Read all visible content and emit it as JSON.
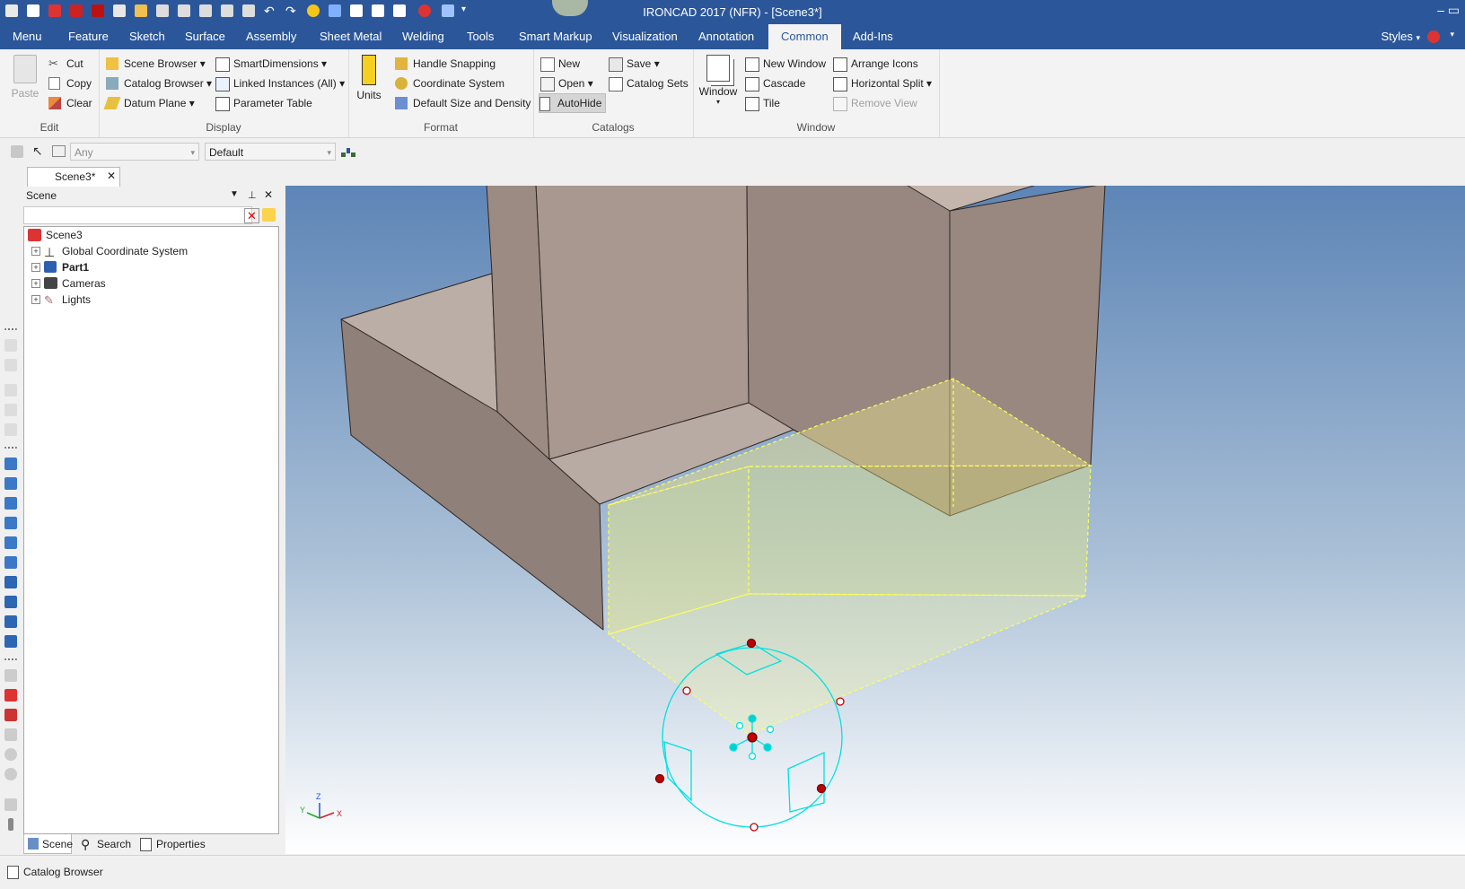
{
  "window": {
    "title": "IRONCAD 2017 (NFR) - [Scene3*]",
    "controls": "–  ▭"
  },
  "tabs": [
    {
      "label": "Menu"
    },
    {
      "label": "Feature"
    },
    {
      "label": "Sketch"
    },
    {
      "label": "Surface"
    },
    {
      "label": "Assembly"
    },
    {
      "label": "Sheet Metal"
    },
    {
      "label": "Welding"
    },
    {
      "label": "Tools"
    },
    {
      "label": "Smart Markup"
    },
    {
      "label": "Visualization"
    },
    {
      "label": "Annotation"
    },
    {
      "label": "Common"
    },
    {
      "label": "Add-Ins"
    }
  ],
  "styles_label": "Styles",
  "ribbon": {
    "edit": {
      "label": "Edit",
      "paste": "Paste",
      "cut": "Cut",
      "copy": "Copy",
      "clear": "Clear"
    },
    "display": {
      "label": "Display",
      "scene_browser": "Scene Browser",
      "catalog_browser": "Catalog Browser",
      "datum_plane": "Datum Plane",
      "smart_dimensions": "SmartDimensions",
      "linked_instances": "Linked Instances (All)",
      "parameter_table": "Parameter Table"
    },
    "format": {
      "label": "Format",
      "units": "Units",
      "handle_snapping": "Handle Snapping",
      "coordinate_system": "Coordinate System",
      "default_size": "Default Size and Density"
    },
    "catalogs": {
      "label": "Catalogs",
      "new": "New",
      "open": "Open",
      "autohide": "AutoHide",
      "save": "Save",
      "catalog_sets": "Catalog Sets"
    },
    "window": {
      "label": "Window",
      "window": "Window",
      "new_window": "New Window",
      "cascade": "Cascade",
      "tile": "Tile",
      "arrange_icons": "Arrange Icons",
      "horizontal_split": "Horizontal Split",
      "remove_view": "Remove View"
    }
  },
  "selection_bar": {
    "filter_value": "Any",
    "style_value": "Default"
  },
  "document_tab": {
    "label": "Scene3*"
  },
  "scene_panel": {
    "title": "Scene",
    "tree": [
      {
        "label": "Scene3",
        "bold": false
      },
      {
        "label": "Global Coordinate System",
        "bold": false
      },
      {
        "label": "Part1",
        "bold": true
      },
      {
        "label": "Cameras",
        "bold": false
      },
      {
        "label": "Lights",
        "bold": false
      }
    ],
    "tabs": {
      "scene": "Scene",
      "search": "Search",
      "properties": "Properties"
    }
  },
  "triad_labels": {
    "z": "Z",
    "y": "Y",
    "x": "X"
  },
  "status_bar": {
    "catalog_browser": "Catalog Browser"
  }
}
